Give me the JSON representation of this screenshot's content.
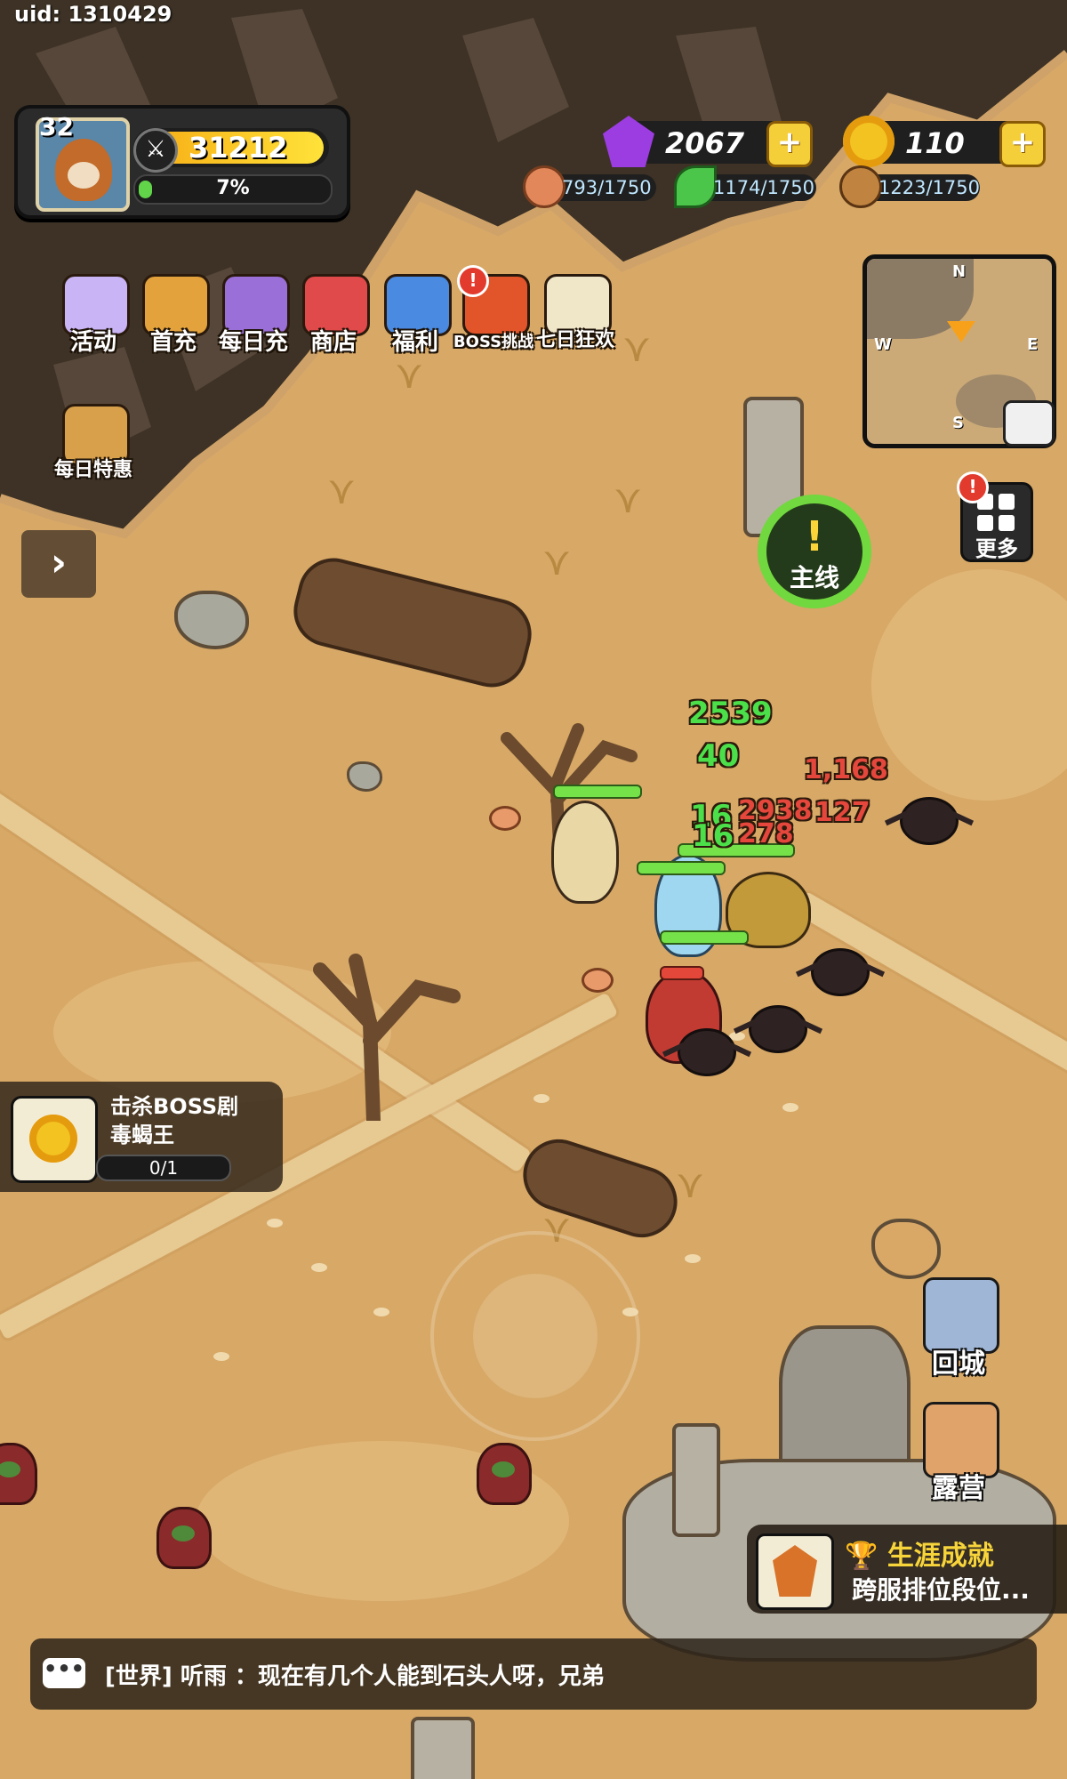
{
  "uid": "uid: 1310429",
  "player": {
    "level": "32",
    "power": "31212",
    "exp_text": "7%",
    "exp_fraction": 0.07
  },
  "currency": {
    "gems": "2067",
    "gold": "110"
  },
  "resources": {
    "meat": "793/1750",
    "leaf": "1174/1750",
    "wood": "1223/1750"
  },
  "menu": [
    {
      "label": "活动",
      "color": "#c9b4f5",
      "icon": "chest-icon"
    },
    {
      "label": "首充",
      "color": "#e3a23b",
      "icon": "king-icon"
    },
    {
      "label": "每日充",
      "color": "#9a6fd8",
      "icon": "gem-cart-icon"
    },
    {
      "label": "商店",
      "color": "#e04a4a",
      "icon": "shop-icon"
    },
    {
      "label": "福利",
      "color": "#4a8ae0",
      "icon": "gift-icon"
    },
    {
      "label": "BOSS挑战",
      "color": "#e2542a",
      "icon": "boss-icon",
      "badge": "!"
    },
    {
      "label": "七日狂欢",
      "color": "#f0e6c8",
      "icon": "seven-day-icon"
    }
  ],
  "daily_deal": {
    "label": "每日特惠"
  },
  "minimap": {
    "n": "N",
    "s": "S",
    "e": "E",
    "w": "W"
  },
  "quest": {
    "mark": "!",
    "label": "主线"
  },
  "more": {
    "label": "更多",
    "badge": "!"
  },
  "battle_numbers": {
    "green": [
      "2539",
      "40",
      "16",
      "16"
    ],
    "red": [
      "1,168",
      "2938",
      "127",
      "278"
    ]
  },
  "task": {
    "title": "击杀BOSS剧",
    "sub": "毒蝎王",
    "progress": "0/1"
  },
  "side_buttons": {
    "return_city": "回城",
    "camp": "露营"
  },
  "achievement": {
    "title": "生涯成就",
    "sub": "跨服排位段位..."
  },
  "chat": {
    "icon": "•••",
    "message": "[世界] 听雨 ：现在有几个人能到石头人呀，兄弟"
  },
  "colors": {
    "accent_green": "#71d83f",
    "gold": "#f2c321",
    "gem": "#9b3de0"
  }
}
